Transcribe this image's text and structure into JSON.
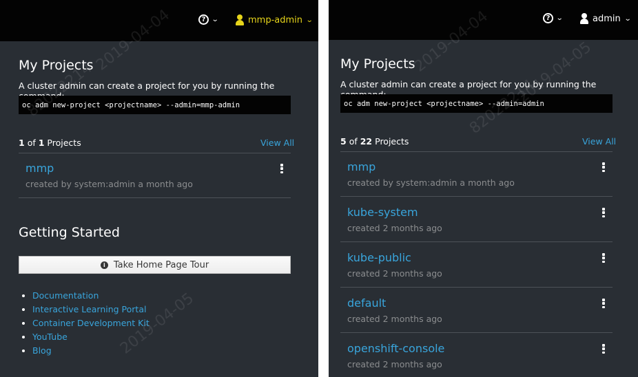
{
  "left": {
    "user": "mmp-admin",
    "my_projects_title": "My Projects",
    "desc": "A cluster admin can create a project for you by running the command:",
    "command": "oc adm new-project <projectname> --admin=mmp-admin",
    "count": {
      "shown": "1",
      "of": "of",
      "total": "1",
      "label": "Projects"
    },
    "view_all": "View All",
    "projects": [
      {
        "name": "mmp",
        "meta": "created by system:admin a month ago"
      }
    ],
    "getting_started_title": "Getting Started",
    "tour_button": "Take Home Page Tour",
    "links": [
      "Documentation",
      "Interactive Learning Portal",
      "Container Development Kit",
      "YouTube",
      "Blog"
    ]
  },
  "right": {
    "user": "admin",
    "my_projects_title": "My Projects",
    "desc": "A cluster admin can create a project for you by running the command:",
    "command": "oc adm new-project <projectname> --admin=admin",
    "count": {
      "shown": "5",
      "of": "of",
      "total": "22",
      "label": "Projects"
    },
    "view_all": "View All",
    "projects": [
      {
        "name": "mmp",
        "meta": "created by system:admin a month ago"
      },
      {
        "name": "kube-system",
        "meta": "created 2 months ago"
      },
      {
        "name": "kube-public",
        "meta": "created 2 months ago"
      },
      {
        "name": "default",
        "meta": "created 2 months ago"
      },
      {
        "name": "openshift-console",
        "meta": "created 2 months ago"
      }
    ]
  },
  "watermarks": [
    "2019-04-04",
    "82022214",
    "2019-04-05"
  ],
  "colors": {
    "link": "#39a5dc",
    "user_highlight": "#e6d41a",
    "panel_bg": "#292e34",
    "topbar_bg": "#030303"
  },
  "icons": [
    "help-icon",
    "user-icon",
    "chevron-down-icon",
    "kebab-icon",
    "info-icon"
  ]
}
